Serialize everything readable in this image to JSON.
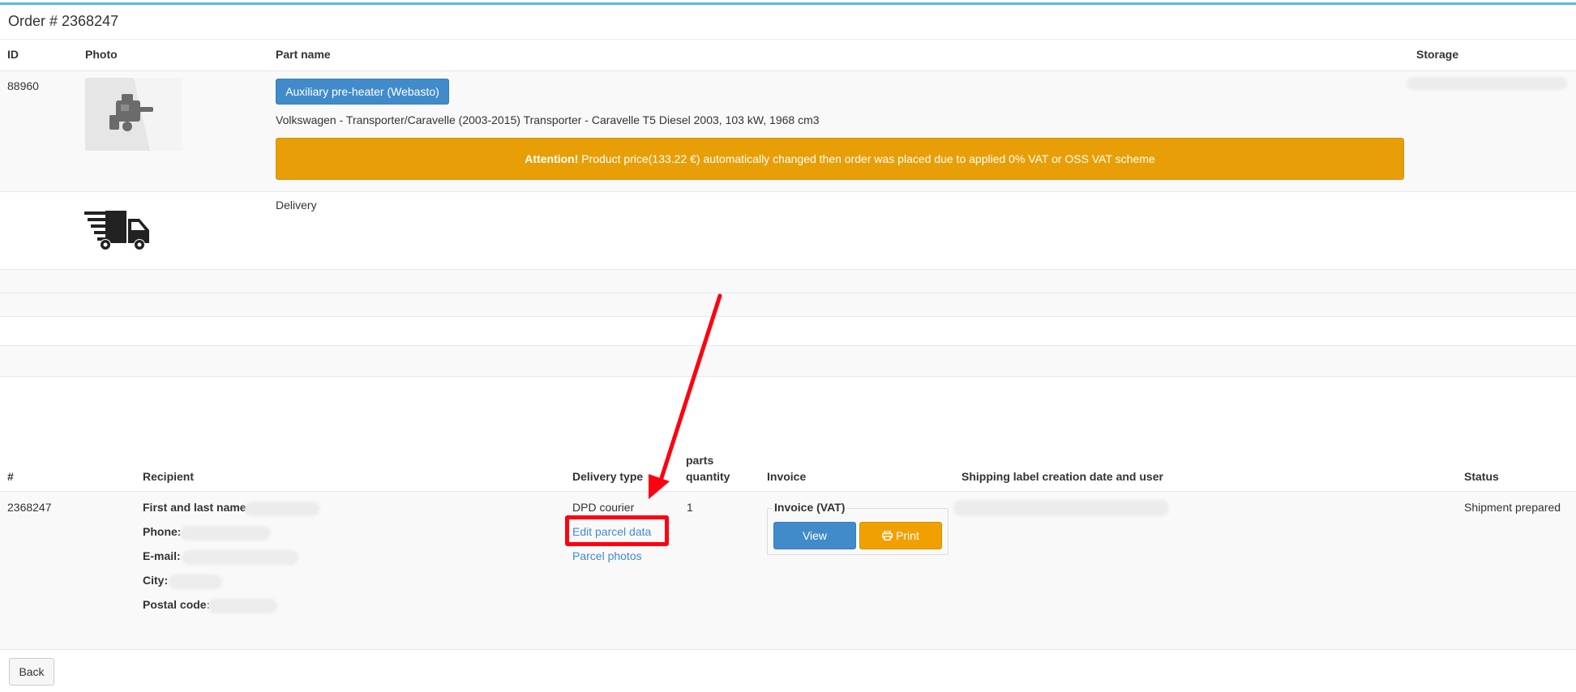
{
  "order": {
    "title": "Order # 2368247"
  },
  "parts_table": {
    "headers": {
      "id": "ID",
      "photo": "Photo",
      "part_name": "Part name",
      "storage": "Storage"
    },
    "row": {
      "id": "88960",
      "part_button": "Auxiliary pre-heater (Webasto)",
      "vehicle": "Volkswagen - Transporter/Caravelle (2003-2015) Transporter - Caravelle T5 Diesel 2003, 103 kW, 1968 cm3",
      "alert_strong": "Attention!",
      "alert_text": " Product price(133.22 €) automatically changed then order was placed due to applied 0% VAT or OSS VAT scheme"
    },
    "delivery_row": {
      "label": "Delivery",
      "icon": "delivery-truck-icon"
    }
  },
  "shipment_table": {
    "headers": {
      "number": "#",
      "recipient": "Recipient",
      "delivery_type": "Delivery type",
      "parts_quantity_line1": "parts",
      "parts_quantity_line2": "quantity",
      "invoice": "Invoice",
      "shipping_label": "Shipping label creation date and user",
      "status": "Status"
    },
    "row": {
      "number": "2368247",
      "recipient_labels": {
        "name": "First and last name:",
        "phone": "Phone:",
        "email": "E-mail:",
        "city": "City:",
        "postal": "Postal code:"
      },
      "delivery_type": "DPD courier",
      "edit_parcel_link": "Edit parcel data",
      "parcel_photos_link": "Parcel photos",
      "parts_quantity": "1",
      "invoice_title": "Invoice (VAT)",
      "view_button": "View",
      "print_button": "Print",
      "status": "Shipment prepared"
    }
  },
  "footer": {
    "back_button": "Back"
  },
  "colors": {
    "accent_blue": "#428bca",
    "warning_orange": "#e89f07",
    "highlight_red": "#ff0010",
    "top_border": "#5bb7e8"
  }
}
